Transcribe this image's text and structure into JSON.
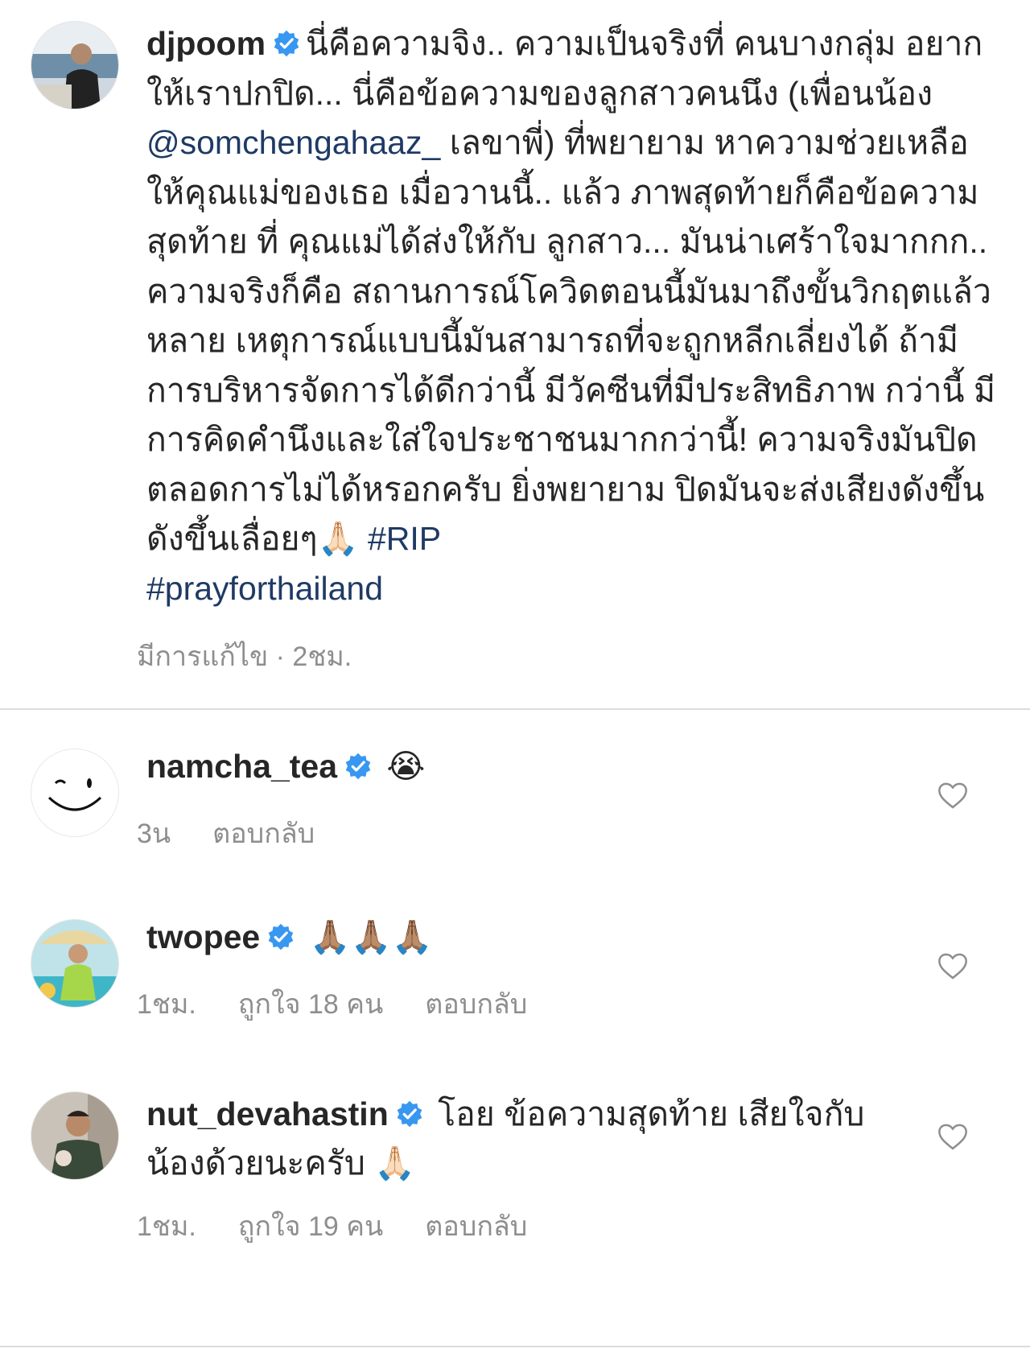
{
  "post": {
    "username": "djpoom",
    "caption_before": "นี่คือความจิง.. ความเป็นจริงที่ คนบางกลุ่ม อยากให้เราปกปิด... นี่คือข้อความของลูกสาวคนนึง (เพื่อนน้อง ",
    "mention": "@somchengahaaz_",
    "caption_middle": " เลขาพี่) ที่พยายาม หาความช่วยเหลือให้คุณแม่ของเธอ เมื่อวานนี้.. แล้ว ภาพสุดท้ายก็คือข้อความ สุดท้าย ที่ คุณแม่ได้ส่งให้กับ ลูกสาว... มันน่าเศร้าใจมากกก.. ความจริงก็คือ สถานการณ์โควิดตอนนี้มันมาถึงขั้นวิกฤตแล้ว หลาย เหตุการณ์แบบนี้มันสามารถที่จะถูกหลีกเลี่ยงได้ ถ้ามี การบริหารจัดการได้ดีกว่านี้ มีวัคซีนที่มีประสิทธิภาพ กว่านี้ มีการคิดคำนึงและใส่ใจประชาชนมากกว่านี้! ความจริงมันปิดตลอดการไม่ได้หรอกครับ ยิ่งพยายาม ปิดมันจะส่งเสียงดังขึ้นดังขึ้นเลื่อยๆ",
    "emoji": "🙏🏻",
    "hashtag1": "#RIP",
    "hashtag2": "#prayforthailand",
    "edited": "มีการแก้ไข · 2ชม."
  },
  "comments": [
    {
      "username": "namcha_tea",
      "text": "😭",
      "time": "3น",
      "reply": "ตอบกลับ",
      "likes": ""
    },
    {
      "username": "twopee",
      "text": "🙏🏽🙏🏽🙏🏽",
      "time": "1ชม.",
      "likes": "ถูกใจ 18 คน",
      "reply": "ตอบกลับ"
    },
    {
      "username": "nut_devahastin",
      "text": "โอย ข้อความสุดท้าย เสียใจกับน้องด้วยนะครับ 🙏🏻",
      "time": "1ชม.",
      "likes": "ถูกใจ 19 คน",
      "reply": "ตอบกลับ"
    }
  ],
  "colors": {
    "verified": "#3897f0",
    "link": "#1f3a64",
    "meta": "#8e8e8e",
    "text": "#262626"
  },
  "icons": {
    "verified": "verified-badge-icon",
    "heart": "heart-outline-icon"
  }
}
